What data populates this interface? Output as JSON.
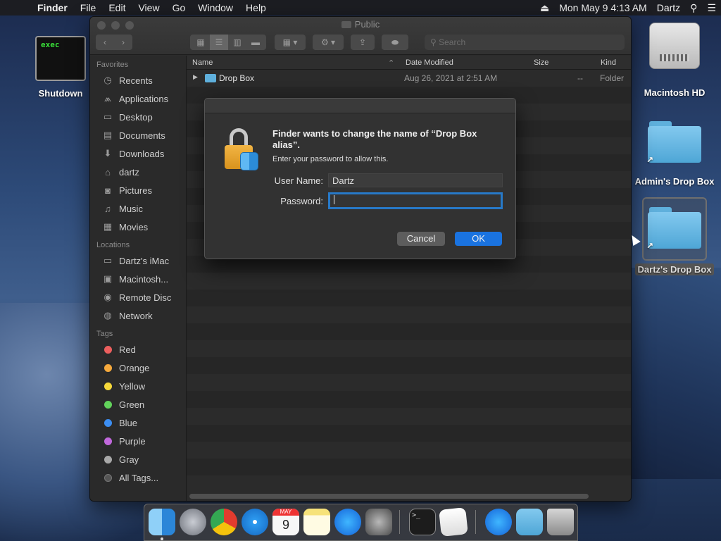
{
  "menubar": {
    "app": "Finder",
    "items": [
      "File",
      "Edit",
      "View",
      "Go",
      "Window",
      "Help"
    ],
    "clock": "Mon May 9  4:13 AM",
    "user": "Dartz"
  },
  "desktop": {
    "exec_text": "exec",
    "shutdown_label": "Shutdown",
    "hd_label": "Macintosh HD",
    "admin_dropbox_label": "Admin's Drop Box",
    "dartz_dropbox_label": "Dartz's Drop Box"
  },
  "window": {
    "title": "Public",
    "search_placeholder": "Search"
  },
  "sidebar": {
    "favorites_header": "Favorites",
    "favorites": [
      "Recents",
      "Applications",
      "Desktop",
      "Documents",
      "Downloads",
      "dartz",
      "Pictures",
      "Music",
      "Movies"
    ],
    "locations_header": "Locations",
    "locations": [
      "Dartz's iMac",
      "Macintosh...",
      "Remote Disc",
      "Network"
    ],
    "tags_header": "Tags",
    "tags": [
      {
        "label": "Red",
        "color": "#ec5f5e"
      },
      {
        "label": "Orange",
        "color": "#f5a93c"
      },
      {
        "label": "Yellow",
        "color": "#f6d83a"
      },
      {
        "label": "Green",
        "color": "#62d35b"
      },
      {
        "label": "Blue",
        "color": "#3c8ef2"
      },
      {
        "label": "Purple",
        "color": "#c168dc"
      },
      {
        "label": "Gray",
        "color": "#a8a8a8"
      }
    ],
    "all_tags": "All Tags..."
  },
  "list": {
    "columns": {
      "name": "Name",
      "date": "Date Modified",
      "size": "Size",
      "kind": "Kind"
    },
    "rows": [
      {
        "name": "Drop Box",
        "date": "Aug 26, 2021 at 2:51 AM",
        "size": "--",
        "kind": "Folder"
      }
    ]
  },
  "dialog": {
    "heading": "Finder wants to change the name of “Drop Box alias”.",
    "subtext": "Enter your password to allow this.",
    "username_label": "User Name:",
    "username_value": "Dartz",
    "password_label": "Password:",
    "password_value": "",
    "cancel_label": "Cancel",
    "ok_label": "OK"
  },
  "dock": {
    "calendar_month": "MAY",
    "calendar_day": "9"
  }
}
